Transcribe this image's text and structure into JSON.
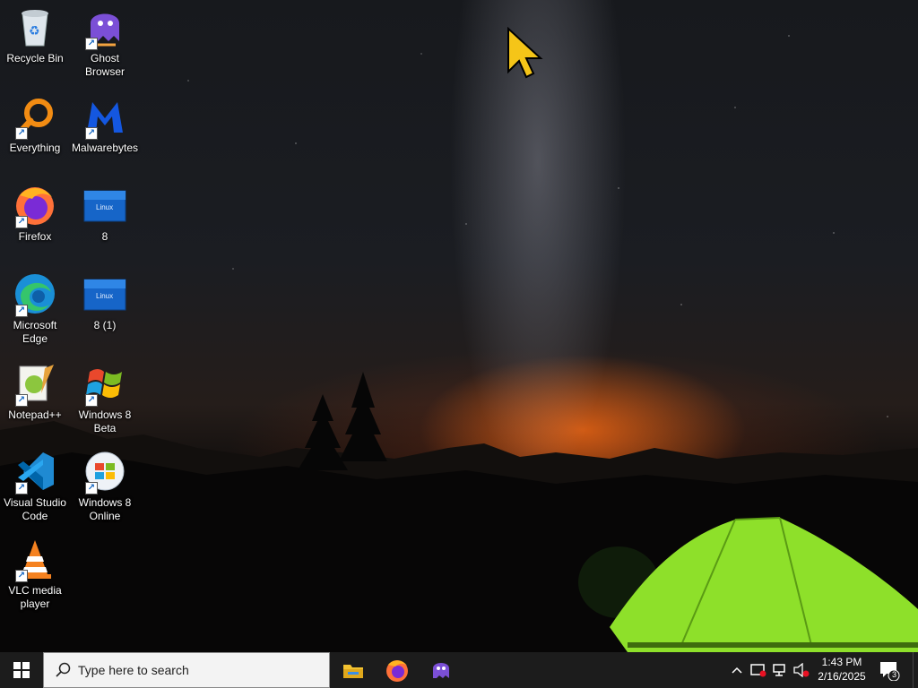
{
  "desktop_icons": [
    {
      "name": "Recycle Bin"
    },
    {
      "name": "Ghost\nBrowser"
    },
    {
      "name": "Everything"
    },
    {
      "name": "Malwarebytes"
    },
    {
      "name": "Firefox"
    },
    {
      "name": "8"
    },
    {
      "name": "Microsoft\nEdge"
    },
    {
      "name": "8 (1)"
    },
    {
      "name": "Notepad++"
    },
    {
      "name": "Windows 8\nBeta"
    },
    {
      "name": "Visual Studio\nCode"
    },
    {
      "name": "Windows 8\nOnline"
    },
    {
      "name": "VLC media\nplayer"
    }
  ],
  "taskbar": {
    "search_placeholder": "Type here to search",
    "pinned": [
      "file-explorer-icon",
      "firefox-icon",
      "ghost-browser-icon"
    ],
    "clock_time": "1:43 PM",
    "clock_date": "2/16/2025",
    "notification_count": "3"
  },
  "thumb_text": "Linux",
  "colors": {
    "taskbar": "#1c1c1c",
    "tent": "#8ee02a",
    "sky_glow": "#ff6e14",
    "cursor": "#f5c518"
  }
}
